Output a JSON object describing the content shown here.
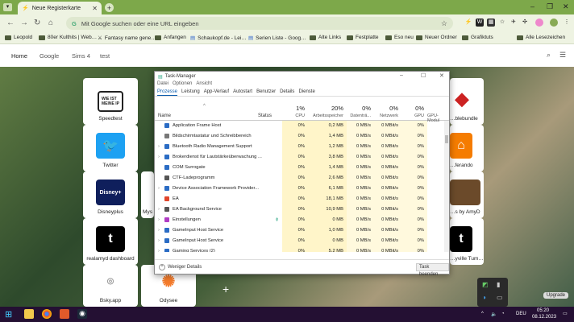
{
  "browser": {
    "tab_title": "Neue Registerkarte",
    "omnibox_placeholder": "Mit Google suchen oder eine URL eingeben",
    "bookmarks": [
      "Leopold",
      "80er Kulthits | Web…",
      "Fantasy name gene…",
      "Anfangen",
      "Schaukopf.de - Lei…",
      "Serien Liste - Goog…",
      "Alte Links",
      "Festplatte",
      "Eso neu",
      "Neuer Ordner",
      "Grafiktuts"
    ],
    "all_bookmarks": "Alle Lesezeichen"
  },
  "ntp": {
    "links": [
      "Home",
      "Google",
      "Sims 4",
      "test"
    ],
    "tiles": [
      "Speedtest",
      "Twitter",
      "Disneyplus",
      "realamyd dashboard",
      "Bsky.app",
      "Odysee"
    ],
    "tiles_partial_left": [
      "Mys"
    ],
    "tiles_right": [
      "…blebundle",
      "…ferando",
      "…s by AmyD",
      "…yville Tum…"
    ]
  },
  "taskmanager": {
    "title": "Task-Manager",
    "menu": [
      "Datei",
      "Optionen",
      "Ansicht"
    ],
    "tabs": [
      "Prozesse",
      "Leistung",
      "App-Verlauf",
      "Autostart",
      "Benutzer",
      "Details",
      "Dienste"
    ],
    "header": {
      "name": "Name",
      "status": "Status",
      "cpu_pct": "1%",
      "cpu": "CPU",
      "mem_pct": "20%",
      "mem": "Arbeitsspeicher",
      "disk_pct": "0%",
      "disk": "Datenträ...",
      "net_pct": "0%",
      "net": "Netzwerk",
      "gpu_pct": "0%",
      "gpu": "GPU",
      "gpuengine": "GPU-Modul"
    },
    "rows": [
      {
        "name": "Application Frame Host",
        "cpu": "0%",
        "mem": "0,2 MB",
        "disk": "0 MB/s",
        "net": "0 MBit/s",
        "gpu": "0%",
        "icon": "#2b6cc4",
        "exp": false
      },
      {
        "name": "Bildschirmtastatur und Schreibbereich",
        "cpu": "0%",
        "mem": "1,4 MB",
        "disk": "0 MB/s",
        "net": "0 MBit/s",
        "gpu": "0%",
        "icon": "#777",
        "exp": false
      },
      {
        "name": "Bluetooth Radio Management Support",
        "cpu": "0%",
        "mem": "1,2 MB",
        "disk": "0 MB/s",
        "net": "0 MBit/s",
        "gpu": "0%",
        "icon": "#2b6cc4",
        "exp": true
      },
      {
        "name": "Brokerdienst für Lautstärkeüberwachung ...",
        "cpu": "0%",
        "mem": "3,8 MB",
        "disk": "0 MB/s",
        "net": "0 MBit/s",
        "gpu": "0%",
        "icon": "#2b6cc4",
        "exp": true
      },
      {
        "name": "COM Surrogate",
        "cpu": "0%",
        "mem": "1,4 MB",
        "disk": "0 MB/s",
        "net": "0 MBit/s",
        "gpu": "0%",
        "icon": "#2b6cc4",
        "exp": false
      },
      {
        "name": "CTF-Ladeprogramm",
        "cpu": "0%",
        "mem": "2,6 MB",
        "disk": "0 MB/s",
        "net": "0 MBit/s",
        "gpu": "0%",
        "icon": "#555",
        "exp": false
      },
      {
        "name": "Device Association Framework Provider...",
        "cpu": "0%",
        "mem": "6,1 MB",
        "disk": "0 MB/s",
        "net": "0 MBit/s",
        "gpu": "0%",
        "icon": "#2b6cc4",
        "exp": true
      },
      {
        "name": "EA",
        "cpu": "0%",
        "mem": "18,1 MB",
        "disk": "0 MB/s",
        "net": "0 MBit/s",
        "gpu": "0%",
        "icon": "#e0452b",
        "exp": false
      },
      {
        "name": "EA Background Service",
        "cpu": "0%",
        "mem": "10,9 MB",
        "disk": "0 MB/s",
        "net": "0 MBit/s",
        "gpu": "0%",
        "icon": "#555",
        "exp": true
      },
      {
        "name": "Einstellungen",
        "cpu": "0%",
        "mem": "0 MB",
        "disk": "0 MB/s",
        "net": "0 MBit/s",
        "gpu": "0%",
        "icon": "#b03cc4",
        "exp": true,
        "status": "ϕ"
      },
      {
        "name": "GameInput Host Service",
        "cpu": "0%",
        "mem": "1,0 MB",
        "disk": "0 MB/s",
        "net": "0 MBit/s",
        "gpu": "0%",
        "icon": "#2b6cc4",
        "exp": true
      },
      {
        "name": "GameInput Host Service",
        "cpu": "0%",
        "mem": "0 MB",
        "disk": "0 MB/s",
        "net": "0 MBit/s",
        "gpu": "0%",
        "icon": "#2b6cc4",
        "exp": true
      },
      {
        "name": "Gaming Services (2)",
        "cpu": "0%",
        "mem": "5,2 MB",
        "disk": "0 MB/s",
        "net": "0 MBit/s",
        "gpu": "0%",
        "icon": "#2b6cc4",
        "exp": true
      }
    ],
    "fewer_details": "Weniger Details",
    "end_task": "Task beenden"
  },
  "taskbar": {
    "clock_time": "05:20",
    "clock_date": "08.12.2023",
    "lang": "DEU",
    "upgrade": "Upgrade"
  }
}
